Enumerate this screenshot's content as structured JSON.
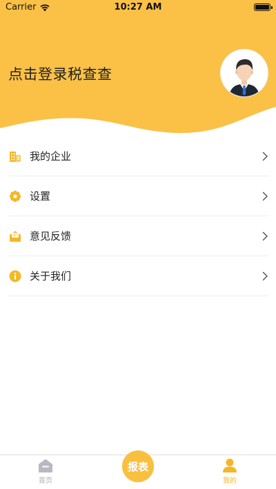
{
  "status_bar": {
    "carrier": "Carrier",
    "time": "10:27 AM"
  },
  "header": {
    "login_prompt": "点击登录税查查",
    "background_color": "#fbc146"
  },
  "menu": {
    "items": [
      {
        "label": "我的企业",
        "icon": "building-icon"
      },
      {
        "label": "设置",
        "icon": "gear-icon"
      },
      {
        "label": "意见反馈",
        "icon": "mail-feedback-icon"
      },
      {
        "label": "关于我们",
        "icon": "info-icon"
      }
    ],
    "icon_color": "#f5b724"
  },
  "tab_bar": {
    "home_label": "首页",
    "report_label": "报表",
    "mine_label": "我的",
    "active_color": "#f5b724",
    "inactive_color": "#b0b0b8"
  }
}
